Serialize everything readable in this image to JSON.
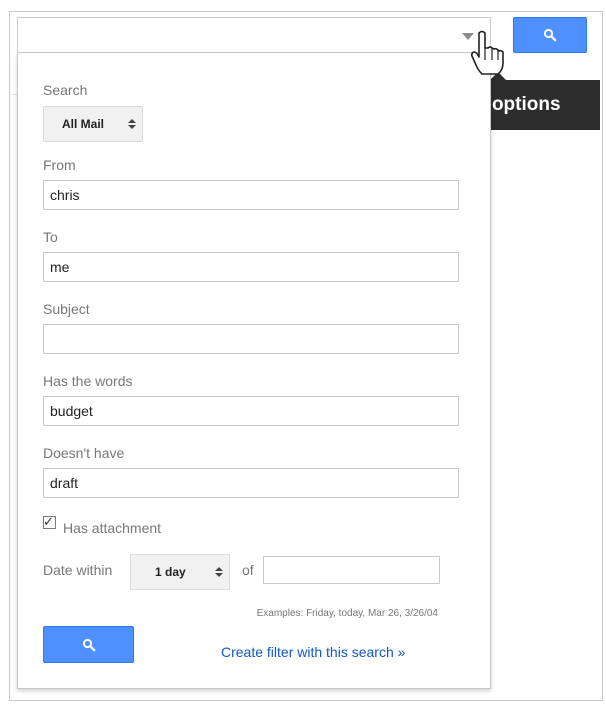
{
  "tooltip": {
    "text": "Show search options"
  },
  "panel": {
    "search_label": "Search",
    "search_scope": "All Mail",
    "from_label": "From",
    "from_value": "chris",
    "to_label": "To",
    "to_value": "me",
    "subject_label": "Subject",
    "subject_value": "",
    "has_words_label": "Has the words",
    "has_words_value": "budget",
    "doesnt_have_label": "Doesn't have",
    "doesnt_have_value": "draft",
    "has_attachment_label": "Has attachment",
    "has_attachment_checked": true,
    "date_within_label": "Date within",
    "date_within_value": "1 day",
    "of_label": "of",
    "date_value": "",
    "examples_text": "Examples: Friday, today, Mar 26, 3/26/04",
    "create_filter_link": "Create filter with this search »"
  },
  "icons": {
    "search": "search-icon",
    "dropdown": "chevron-down-icon",
    "cursor": "hand-cursor-icon"
  },
  "colors": {
    "accent_blue": "#4d90fe",
    "tooltip_bg": "#2d2d2d",
    "link": "#1155cc"
  }
}
